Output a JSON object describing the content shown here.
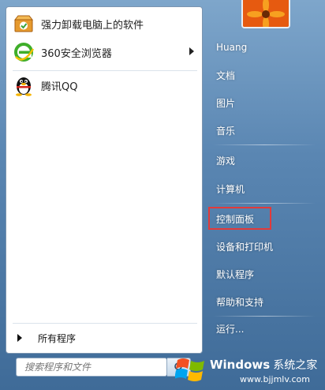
{
  "left_panel": {
    "pinned_apps": [
      {
        "label": "强力卸载电脑上的软件",
        "icon": "uninstaller-box-icon"
      },
      {
        "label": "360安全浏览器",
        "icon": "360-browser-icon",
        "has_submenu": true
      }
    ],
    "recent_apps": [
      {
        "label": "腾讯QQ",
        "icon": "qq-penguin-icon"
      }
    ],
    "all_programs_label": "所有程序"
  },
  "search": {
    "placeholder": "搜索程序和文件"
  },
  "right_panel": {
    "items": [
      {
        "label": "Huang"
      },
      {
        "label": "文档"
      },
      {
        "label": "图片"
      },
      {
        "label": "音乐"
      },
      {
        "label": "游戏"
      },
      {
        "label": "计算机"
      },
      {
        "label": "控制面板",
        "highlighted": true
      },
      {
        "label": "设备和打印机"
      },
      {
        "label": "默认程序"
      },
      {
        "label": "帮助和支持"
      },
      {
        "label": "运行..."
      }
    ]
  },
  "watermark": {
    "brand": "Windows",
    "brand_cn": "系统之家",
    "url": "www.bjjmlv.com"
  },
  "colors": {
    "highlight_border": "#e23a3a",
    "frame_blue": "#5a86b0"
  }
}
